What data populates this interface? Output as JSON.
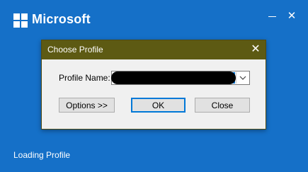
{
  "app": {
    "brand": "Microsoft",
    "status": "Loading Profile",
    "window_controls": {
      "minimize_icon": "minimize-icon",
      "close_icon": "close-icon",
      "close_glyph": "✕"
    },
    "colors": {
      "background": "#1570c8",
      "dialog_titlebar": "#5d5a13",
      "accent": "#0078d7"
    }
  },
  "dialog": {
    "title": "Choose Profile",
    "close_glyph": "✕",
    "profile_label": "Profile Name:",
    "profile_value": "",
    "buttons": {
      "options": "Options >>",
      "ok": "OK",
      "close": "Close"
    }
  }
}
